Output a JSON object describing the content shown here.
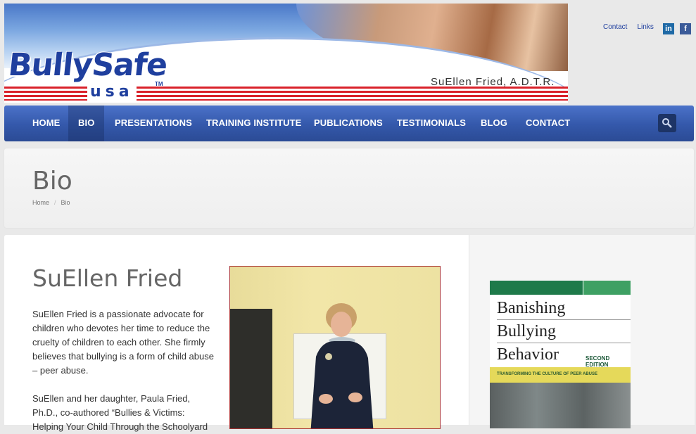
{
  "header": {
    "logo_main": "BullySafe",
    "logo_sub": "usa",
    "logo_tm": "TM",
    "banner_name": "SuEllen Fried, A.D.T.R.",
    "top_links": [
      "Contact",
      "Links"
    ],
    "social": [
      {
        "name": "linkedin-icon",
        "glyph": "in"
      },
      {
        "name": "facebook-icon",
        "glyph": "f"
      }
    ]
  },
  "nav": {
    "items": [
      "HOME",
      "BIO",
      "PRESENTATIONS",
      "TRAINING INSTITUTE",
      "PUBLICATIONS",
      "TESTIMONIALS",
      "BLOG",
      "CONTACT"
    ],
    "active": "BIO"
  },
  "page": {
    "title": "Bio",
    "breadcrumb": [
      "Home",
      "Bio"
    ],
    "breadcrumb_sep": "/"
  },
  "main": {
    "heading": "SuEllen Fried",
    "paragraphs": [
      "SuEllen Fried is a passionate advocate for children who devotes her time to reduce the cruelty of children to each other. She firmly believes that bullying is a form of child abuse – peer abuse.",
      "SuEllen and her daughter, Paula Fried, Ph.D., co-authored “Bullies & Victims: Helping Your Child Through the Schoolyard"
    ]
  },
  "sidebar": {
    "book_lines": [
      "Banishing",
      "Bullying",
      "Behavior"
    ],
    "book_edition": "SECOND EDITION",
    "book_tagline": "TRANSFORMING THE CULTURE OF PEER ABUSE"
  },
  "colors": {
    "nav": "#3458aa",
    "brand": "#1f3f9e",
    "stripe": "#d9212a"
  }
}
